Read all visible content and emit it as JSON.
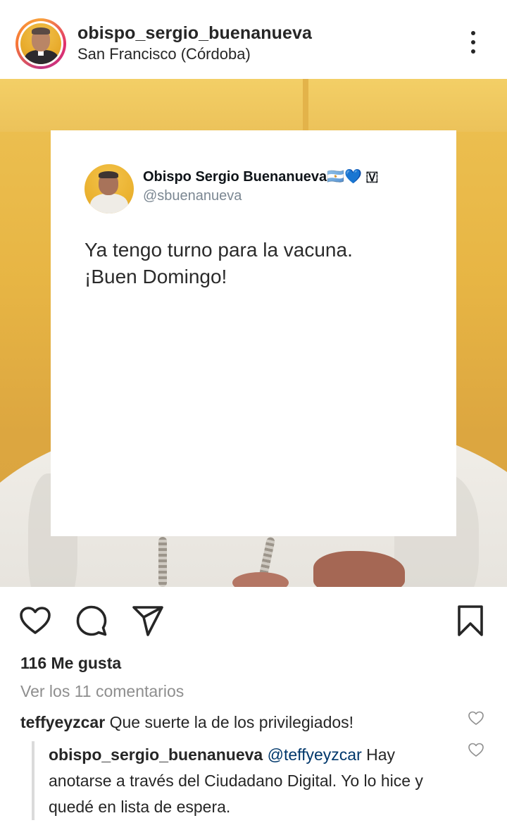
{
  "header": {
    "username": "obispo_sergio_buenanueva",
    "location": "San Francisco (Córdoba)"
  },
  "tweet": {
    "display_name": "Obispo Sergio Buenanueva🇦🇷💙 🇻",
    "handle": "@sbuenanueva",
    "text_line1": "Ya tengo turno para la vacuna.",
    "text_line2": "¡Buen Domingo!"
  },
  "actions": {
    "icons": [
      "heart-icon",
      "comment-icon",
      "share-icon",
      "bookmark-icon"
    ]
  },
  "likes": "116 Me gusta",
  "view_comments": "Ver los 11 comentarios",
  "comments": [
    {
      "user": "teffyeyzcar",
      "text": "Que suerte la de los privilegiados!"
    }
  ],
  "reply": {
    "user": "obispo_sergio_buenanueva",
    "mention": "@teffyeyzcar",
    "text": "Hay anotarse a través del Ciudadano Digital.  Yo lo hice y quedé en lista de espera."
  },
  "colors": {
    "text": "#262626",
    "muted": "#8e8e8e",
    "mention": "#00376b",
    "background_yellow": "#e7b544"
  }
}
